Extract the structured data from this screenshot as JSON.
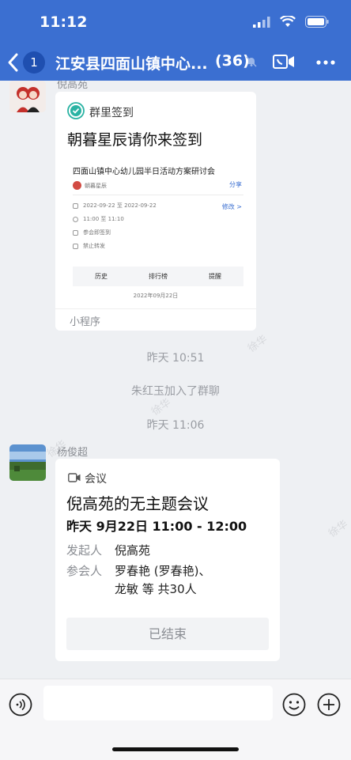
{
  "status_bar": {
    "time": "11:12"
  },
  "header": {
    "unread_count": "1",
    "chat_title": "江安县四面山镇中心...",
    "member_count": "(36)",
    "accent_color": "#3b6fd1"
  },
  "messages": {
    "msg1": {
      "sender": "倪高苑",
      "app_name": "群里签到",
      "heading": "朝暮星辰请你来签到",
      "preview": {
        "event_title": "四面山镇中心幼儿园半日活动方案研讨会",
        "share_label": "分享",
        "organizer": "朝暮星辰",
        "date_range": "2022-09-22 至 2022-09-22",
        "edit_label": "修改 >",
        "time_range": "11:00 至 11:10",
        "rule_1": "参会即签到",
        "rule_2": "禁止转发",
        "tab_1": "历史",
        "tab_2": "排行榜",
        "tab_3": "提醒",
        "current_date": "2022年09月22日"
      },
      "footer_label": "小程序"
    },
    "sys_time_1": "昨天 10:51",
    "sys_join": "朱红玉加入了群聊",
    "sys_time_2": "昨天 11:06",
    "msg2": {
      "sender": "杨俊超",
      "app_name": "会议",
      "title": "倪高苑的无主题会议",
      "time": "昨天 9月22日 11:00 - 12:00",
      "organizer_label": "发起人",
      "organizer_value": "倪高苑",
      "attendees_label": "参会人",
      "attendees_line_1": "罗春艳 (罗春艳)、",
      "attendees_line_2": "龙敏 等 共30人",
      "status": "已结束"
    }
  },
  "watermark": "徐华",
  "input": {
    "placeholder": ""
  },
  "icons": [
    "back-icon",
    "mute-icon",
    "video-call-icon",
    "more-icon",
    "checkin-icon",
    "meeting-icon",
    "voice-icon",
    "emoji-icon",
    "plus-icon"
  ]
}
